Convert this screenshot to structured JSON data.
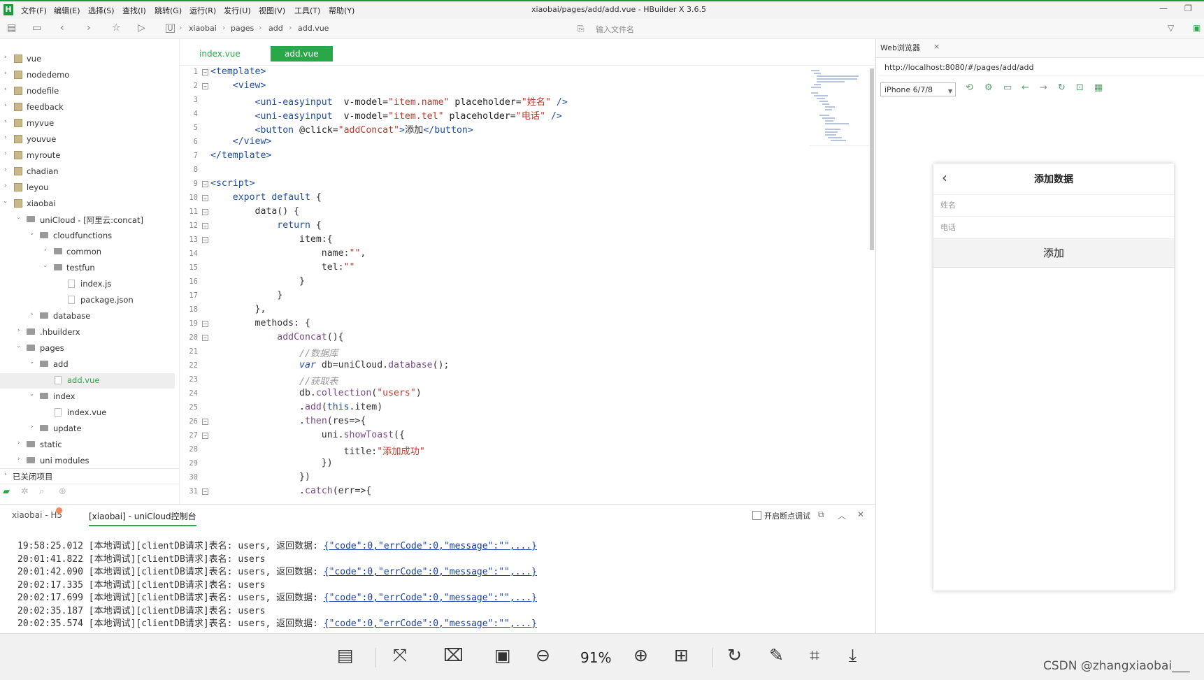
{
  "window": {
    "title": "xiaobai/pages/add/add.vue - HBuilder X 3.6.5",
    "menus": [
      "文件(F)",
      "编辑(E)",
      "选择(S)",
      "查找(I)",
      "跳转(G)",
      "运行(R)",
      "发行(U)",
      "视图(V)",
      "工具(T)",
      "帮助(Y)"
    ],
    "logo": "H"
  },
  "toolbar": {
    "breadcrumb": [
      "xiaobai",
      "pages",
      "add",
      "add.vue"
    ],
    "search_placeholder": "输入文件名"
  },
  "sidebar": {
    "items": [
      {
        "label": "vue"
      },
      {
        "label": "nodedemo"
      },
      {
        "label": "nodefile"
      },
      {
        "label": "feedback"
      },
      {
        "label": "myvue"
      },
      {
        "label": "youvue"
      },
      {
        "label": "myroute"
      },
      {
        "label": "chadian"
      },
      {
        "label": "leyou"
      },
      {
        "label": "xiaobai"
      },
      {
        "label": "uniCloud - [阿里云:concat]"
      },
      {
        "label": "cloudfunctions"
      },
      {
        "label": "common"
      },
      {
        "label": "testfun"
      },
      {
        "label": "index.js"
      },
      {
        "label": "package.json"
      },
      {
        "label": "database"
      },
      {
        "label": ".hbuilderx"
      },
      {
        "label": "pages"
      },
      {
        "label": "add"
      },
      {
        "label": "add.vue"
      },
      {
        "label": "index"
      },
      {
        "label": "index.vue"
      },
      {
        "label": "update"
      },
      {
        "label": "static"
      },
      {
        "label": "uni modules"
      }
    ],
    "closed_projects": "已关闭项目"
  },
  "editor": {
    "tabs": [
      "index.vue",
      "add.vue"
    ],
    "line_numbers": [
      "1",
      "2",
      "3",
      "4",
      "5",
      "6",
      "7",
      "8",
      "9",
      "10",
      "11",
      "12",
      "13",
      "14",
      "15",
      "16",
      "17",
      "18",
      "19",
      "20",
      "21",
      "22",
      "23",
      "24",
      "25",
      "26",
      "27",
      "28",
      "29",
      "30",
      "31"
    ]
  },
  "browser": {
    "tab_label": "Web浏览器",
    "close": "×",
    "url": "http://localhost:8080/#/pages/add/add",
    "device": "iPhone 6/7/8",
    "page_title": "添加数据",
    "name_placeholder": "姓名",
    "tel_placeholder": "电话",
    "add_button": "添加"
  },
  "console": {
    "tabs": [
      "xiaobai - H5",
      "[xiaobai] - uniCloud控制台"
    ],
    "breakpoint_label": "开启断点调试",
    "rows": [
      {
        "text": "19:58:25.012 [本地调试][clientDB请求]表名: users, 返回数据: ",
        "link": "{\"code\":0,\"errCode\":0,\"message\":\"\",...}"
      },
      {
        "text": "20:01:41.822 [本地调试][clientDB请求]表名: users",
        "link": ""
      },
      {
        "text": "20:01:42.090 [本地调试][clientDB请求]表名: users, 返回数据: ",
        "link": "{\"code\":0,\"errCode\":0,\"message\":\"\",...}"
      },
      {
        "text": "20:02:17.335 [本地调试][clientDB请求]表名: users",
        "link": ""
      },
      {
        "text": "20:02:17.699 [本地调试][clientDB请求]表名: users, 返回数据: ",
        "link": "{\"code\":0,\"errCode\":0,\"message\":\"\",...}"
      },
      {
        "text": "20:02:35.187 [本地调试][clientDB请求]表名: users",
        "link": ""
      },
      {
        "text": "20:02:35.574 [本地调试][clientDB请求]表名: users, 返回数据: ",
        "link": "{\"code\":0,\"errCode\":0,\"message\":\"\",...}"
      }
    ]
  },
  "viewer": {
    "zoom": "91%",
    "watermark": "CSDN @zhangxiaobai___"
  },
  "colors": {
    "accent": "#2aa848",
    "keyword": "#1f4fa8",
    "string": "#c0392b"
  }
}
